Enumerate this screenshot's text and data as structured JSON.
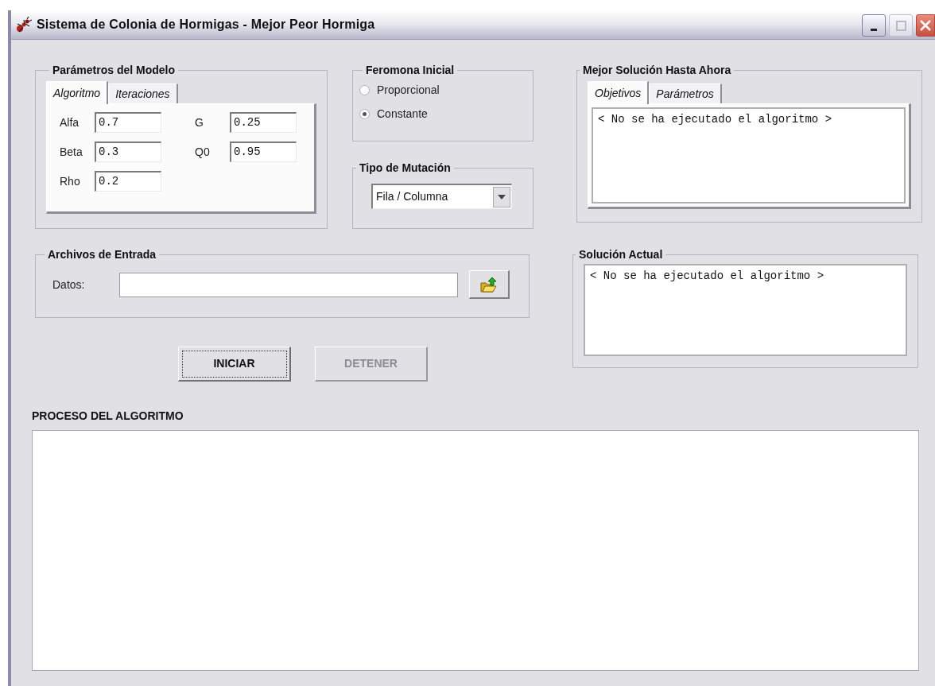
{
  "window": {
    "title": "Sistema de Colonia de Hormigas - Mejor Peor Hormiga"
  },
  "model_parameters": {
    "title": "Parámetros del Modelo",
    "tabs": [
      {
        "label": "Algoritmo",
        "selected": true
      },
      {
        "label": "Iteraciones",
        "selected": false
      }
    ],
    "fields": [
      {
        "label": "Alfa",
        "value": "0.7"
      },
      {
        "label": "G",
        "value": "0.25"
      },
      {
        "label": "Beta",
        "value": "0.3"
      },
      {
        "label": "Q0",
        "value": "0.95"
      },
      {
        "label": "Rho",
        "value": "0.2"
      }
    ]
  },
  "initial_pheromone": {
    "title": "Feromona Inicial",
    "options": [
      {
        "label": "Proporcional",
        "selected": false
      },
      {
        "label": "Constante",
        "selected": true
      }
    ]
  },
  "mutation_type": {
    "title": "Tipo de Mutación",
    "value": "Fila / Columna"
  },
  "best_solution": {
    "title": "Mejor Solución Hasta Ahora",
    "tabs": [
      {
        "label": "Objetivos",
        "selected": true
      },
      {
        "label": "Parámetros",
        "selected": false
      }
    ],
    "text": "< No se ha ejecutado el algoritmo >"
  },
  "input_files": {
    "title": "Archivos de Entrada",
    "label": "Datos:"
  },
  "current_solution": {
    "title": "Solución Actual",
    "text": "< No se ha ejecutado el algoritmo >"
  },
  "buttons": [
    {
      "label": "INICIAR",
      "disabled": false
    },
    {
      "label": "DETENER",
      "disabled": true
    }
  ],
  "process": {
    "title": "PROCESO DEL ALGORITMO"
  }
}
